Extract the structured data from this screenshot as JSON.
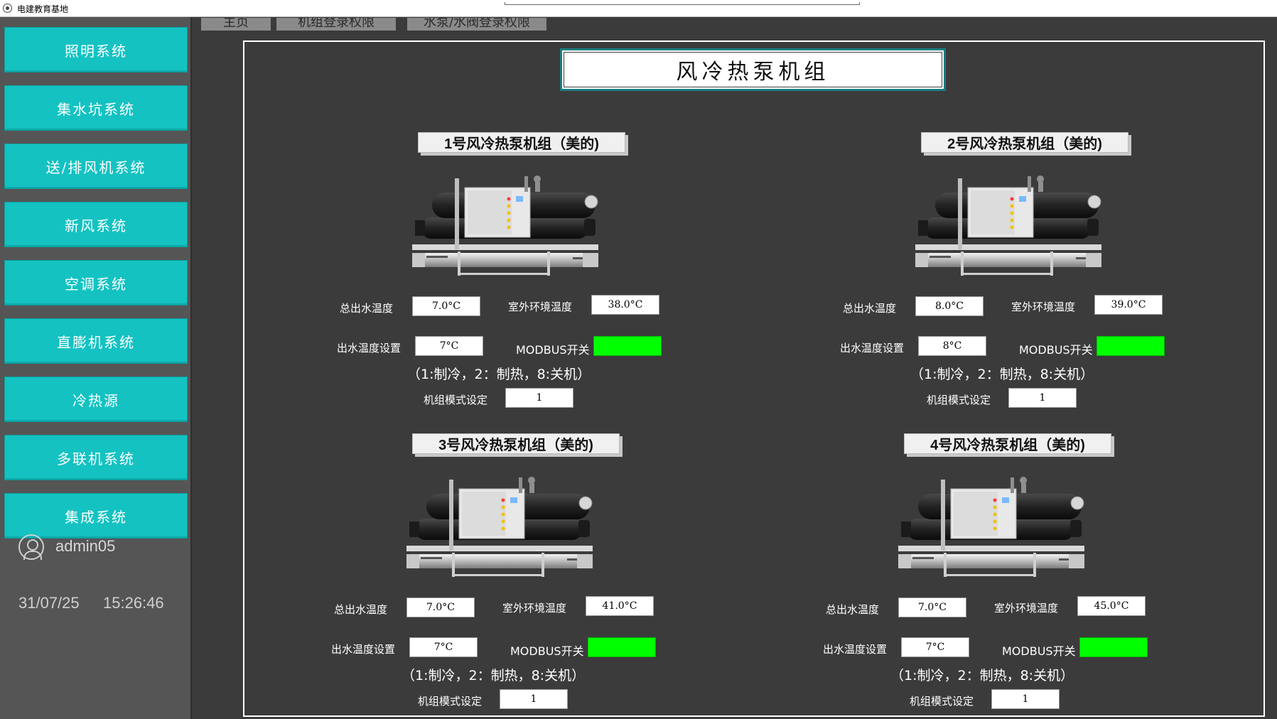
{
  "window": {
    "title": "电建教育基地"
  },
  "sidebar": {
    "items": [
      {
        "label": "照明系统"
      },
      {
        "label": "集水坑系统"
      },
      {
        "label": "送/排风机系统"
      },
      {
        "label": "新风系统"
      },
      {
        "label": "空调系统"
      },
      {
        "label": "直膨机系统"
      },
      {
        "label": "冷热源"
      },
      {
        "label": "多联机系统"
      },
      {
        "label": "集成系统"
      }
    ],
    "user": {
      "name": "admin05",
      "icon": "user-icon"
    },
    "date": "31/07/25",
    "time": "15:26:46"
  },
  "tabs": [
    {
      "label": "主页"
    },
    {
      "label": "机组登录权限"
    },
    {
      "label": "水泵/水阀登录权限"
    }
  ],
  "main": {
    "title": "风冷热泵机组"
  },
  "labels": {
    "supply_temp": "总出水温度",
    "outdoor_temp": "室外环境温度",
    "setpoint": "出水温度设置",
    "modbus": "MODBUS开关",
    "mode_hint": "（1:制冷，2：制热，8:关机）",
    "mode_setting": "机组模式设定"
  },
  "units": [
    {
      "title": "1号风冷热泵机组（美的)",
      "supply_temp": "7.0°C",
      "outdoor_temp": "38.0°C",
      "setpoint": "7°C",
      "modbus_on": true,
      "mode": "1"
    },
    {
      "title": "2号风冷热泵机组（美的)",
      "supply_temp": "8.0°C",
      "outdoor_temp": "39.0°C",
      "setpoint": "8°C",
      "modbus_on": true,
      "mode": "1"
    },
    {
      "title": "3号风冷热泵机组（美的)",
      "supply_temp": "7.0°C",
      "outdoor_temp": "41.0°C",
      "setpoint": "7°C",
      "modbus_on": true,
      "mode": "1"
    },
    {
      "title": "4号风冷热泵机组（美的)",
      "supply_temp": "7.0°C",
      "outdoor_temp": "45.0°C",
      "setpoint": "7°C",
      "modbus_on": true,
      "mode": "1"
    }
  ],
  "colors": {
    "accent": "#14c2c2",
    "modbus_on": "#00ff00",
    "background": "#3b3b3b",
    "sidebar": "#555555"
  }
}
